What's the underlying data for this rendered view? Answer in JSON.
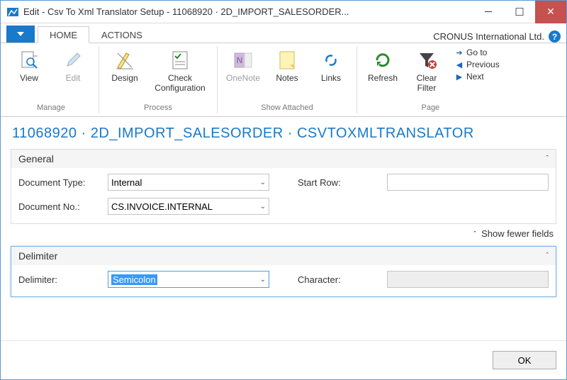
{
  "titlebar": {
    "text": "Edit - Csv To Xml Translator Setup - 11068920 · 2D_IMPORT_SALESORDER..."
  },
  "tabs": {
    "home": "HOME",
    "actions": "ACTIONS"
  },
  "company": "CRONUS International Ltd.",
  "ribbon": {
    "view": "View",
    "edit": "Edit",
    "design": "Design",
    "check_config": "Check Configuration",
    "onenote": "OneNote",
    "notes": "Notes",
    "links": "Links",
    "refresh": "Refresh",
    "clear_filter": "Clear Filter",
    "goto": "Go to",
    "previous": "Previous",
    "next": "Next",
    "grp_manage": "Manage",
    "grp_process": "Process",
    "grp_show": "Show Attached",
    "grp_page": "Page"
  },
  "page_title": "11068920 · 2D_IMPORT_SALESORDER · CSVTOXMLTRANSLATOR",
  "fasttabs": {
    "general": {
      "caption": "General",
      "document_type_lbl": "Document Type:",
      "document_type_val": "Internal",
      "document_no_lbl": "Document No.:",
      "document_no_val": "CS.INVOICE.INTERNAL",
      "start_row_lbl": "Start Row:",
      "start_row_val": ""
    },
    "delimiter": {
      "caption": "Delimiter",
      "delimiter_lbl": "Delimiter:",
      "delimiter_val": "Semicolon",
      "character_lbl": "Character:",
      "character_val": ""
    }
  },
  "show_fewer": "Show fewer fields",
  "ok": "OK"
}
